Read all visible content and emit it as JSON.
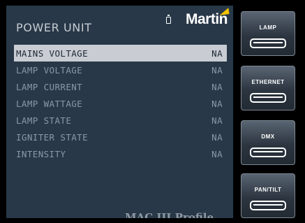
{
  "header": {
    "title": "POWER UNIT",
    "logo_text": "Martin",
    "battery_icon": "battery-icon",
    "logo_accent_color": "#f4c300"
  },
  "rows": [
    {
      "label": "MAINS VOLTAGE",
      "value": "NA",
      "selected": true
    },
    {
      "label": "LAMP VOLTAGE",
      "value": "NA"
    },
    {
      "label": "LAMP CURRENT",
      "value": "NA"
    },
    {
      "label": "LAMP WATTAGE",
      "value": "NA"
    },
    {
      "label": "LAMP STATE",
      "value": "NA"
    },
    {
      "label": "IGNITER STATE",
      "value": "NA"
    },
    {
      "label": "INTENSITY",
      "value": "NA"
    }
  ],
  "footer": {
    "model": "MAC III Profile"
  },
  "softkeys": [
    {
      "label": "LAMP"
    },
    {
      "label": "ETHERNET"
    },
    {
      "label": "DMX"
    },
    {
      "label": "PAN/TILT"
    }
  ]
}
